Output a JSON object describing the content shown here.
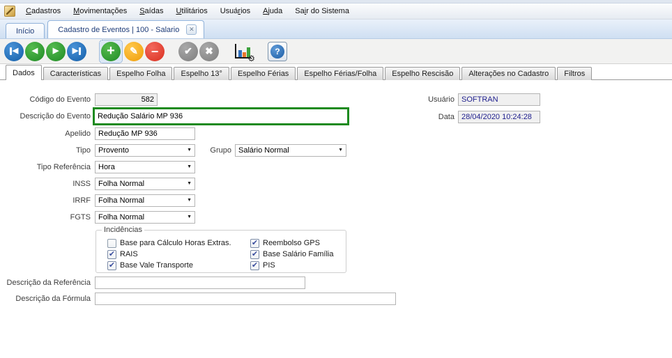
{
  "menubar": {
    "items": [
      {
        "pre": "",
        "mn": "C",
        "post": "adastros"
      },
      {
        "pre": "",
        "mn": "M",
        "post": "ovimentações"
      },
      {
        "pre": "",
        "mn": "S",
        "post": "aídas"
      },
      {
        "pre": "",
        "mn": "U",
        "post": "tilitários"
      },
      {
        "pre": "Usuá",
        "mn": "r",
        "post": "ios"
      },
      {
        "pre": "",
        "mn": "A",
        "post": "juda"
      },
      {
        "pre": "Sa",
        "mn": "i",
        "post": "r do Sistema"
      }
    ]
  },
  "doc_tabs": {
    "home": "Início",
    "active": "Cadastro de Eventos | 100 - Salario"
  },
  "icons": {
    "prev_triangle": "◀",
    "next_triangle": "▶",
    "plus": "+",
    "pencil": "✎",
    "minus": "−",
    "check": "✔",
    "cross": "✖",
    "gear": "⚙",
    "help": "?",
    "close_x": "✕",
    "dropdown_arrow": "▼"
  },
  "page_tabs": [
    {
      "label": "Dados",
      "active": true
    },
    {
      "label": "Características",
      "active": false
    },
    {
      "label": "Espelho Folha",
      "active": false
    },
    {
      "label": "Espelho 13°",
      "active": false
    },
    {
      "label": "Espelho Férias",
      "active": false
    },
    {
      "label": "Espelho Férias/Folha",
      "active": false
    },
    {
      "label": "Espelho Rescisão",
      "active": false
    },
    {
      "label": "Alterações no Cadastro",
      "active": false
    },
    {
      "label": "Filtros",
      "active": false
    }
  ],
  "form": {
    "codigo": {
      "label": "Código do Evento",
      "value": "582"
    },
    "descricao": {
      "label": "Descrição do Evento",
      "value": "Redução Salário MP 936"
    },
    "apelido": {
      "label": "Apelido",
      "value": "Redução MP 936"
    },
    "tipo": {
      "label": "Tipo",
      "value": "Provento"
    },
    "grupo": {
      "label": "Grupo",
      "value": "Salário Normal"
    },
    "tipo_referencia": {
      "label": "Tipo Referência",
      "value": "Hora"
    },
    "inss": {
      "label": "INSS",
      "value": "Folha Normal"
    },
    "irrf": {
      "label": "IRRF",
      "value": "Folha Normal"
    },
    "fgts": {
      "label": "FGTS",
      "value": "Folha Normal"
    },
    "incidencias": {
      "title": "Incidências",
      "checkboxes": [
        {
          "label": "Base para Cálculo Horas Extras.",
          "checked": false
        },
        {
          "label": "RAIS",
          "checked": true
        },
        {
          "label": "Base Vale Transporte",
          "checked": true
        },
        {
          "label": "Reembolso GPS",
          "checked": true
        },
        {
          "label": "Base Salário Família",
          "checked": true
        },
        {
          "label": "PIS",
          "checked": true
        }
      ]
    },
    "descricao_referencia": {
      "label": "Descrição da Referência",
      "value": ""
    },
    "descricao_formula": {
      "label": "Descrição da Fórmula",
      "value": ""
    },
    "usuario": {
      "label": "Usuário",
      "value": "SOFTRAN"
    },
    "data": {
      "label": "Data",
      "value": "28/04/2020 10:24:28"
    }
  },
  "colors": {
    "focus_border_green": "#1d8a1f",
    "navy_value_text": "#20208e",
    "doc_tab_text": "#1e3c78"
  }
}
